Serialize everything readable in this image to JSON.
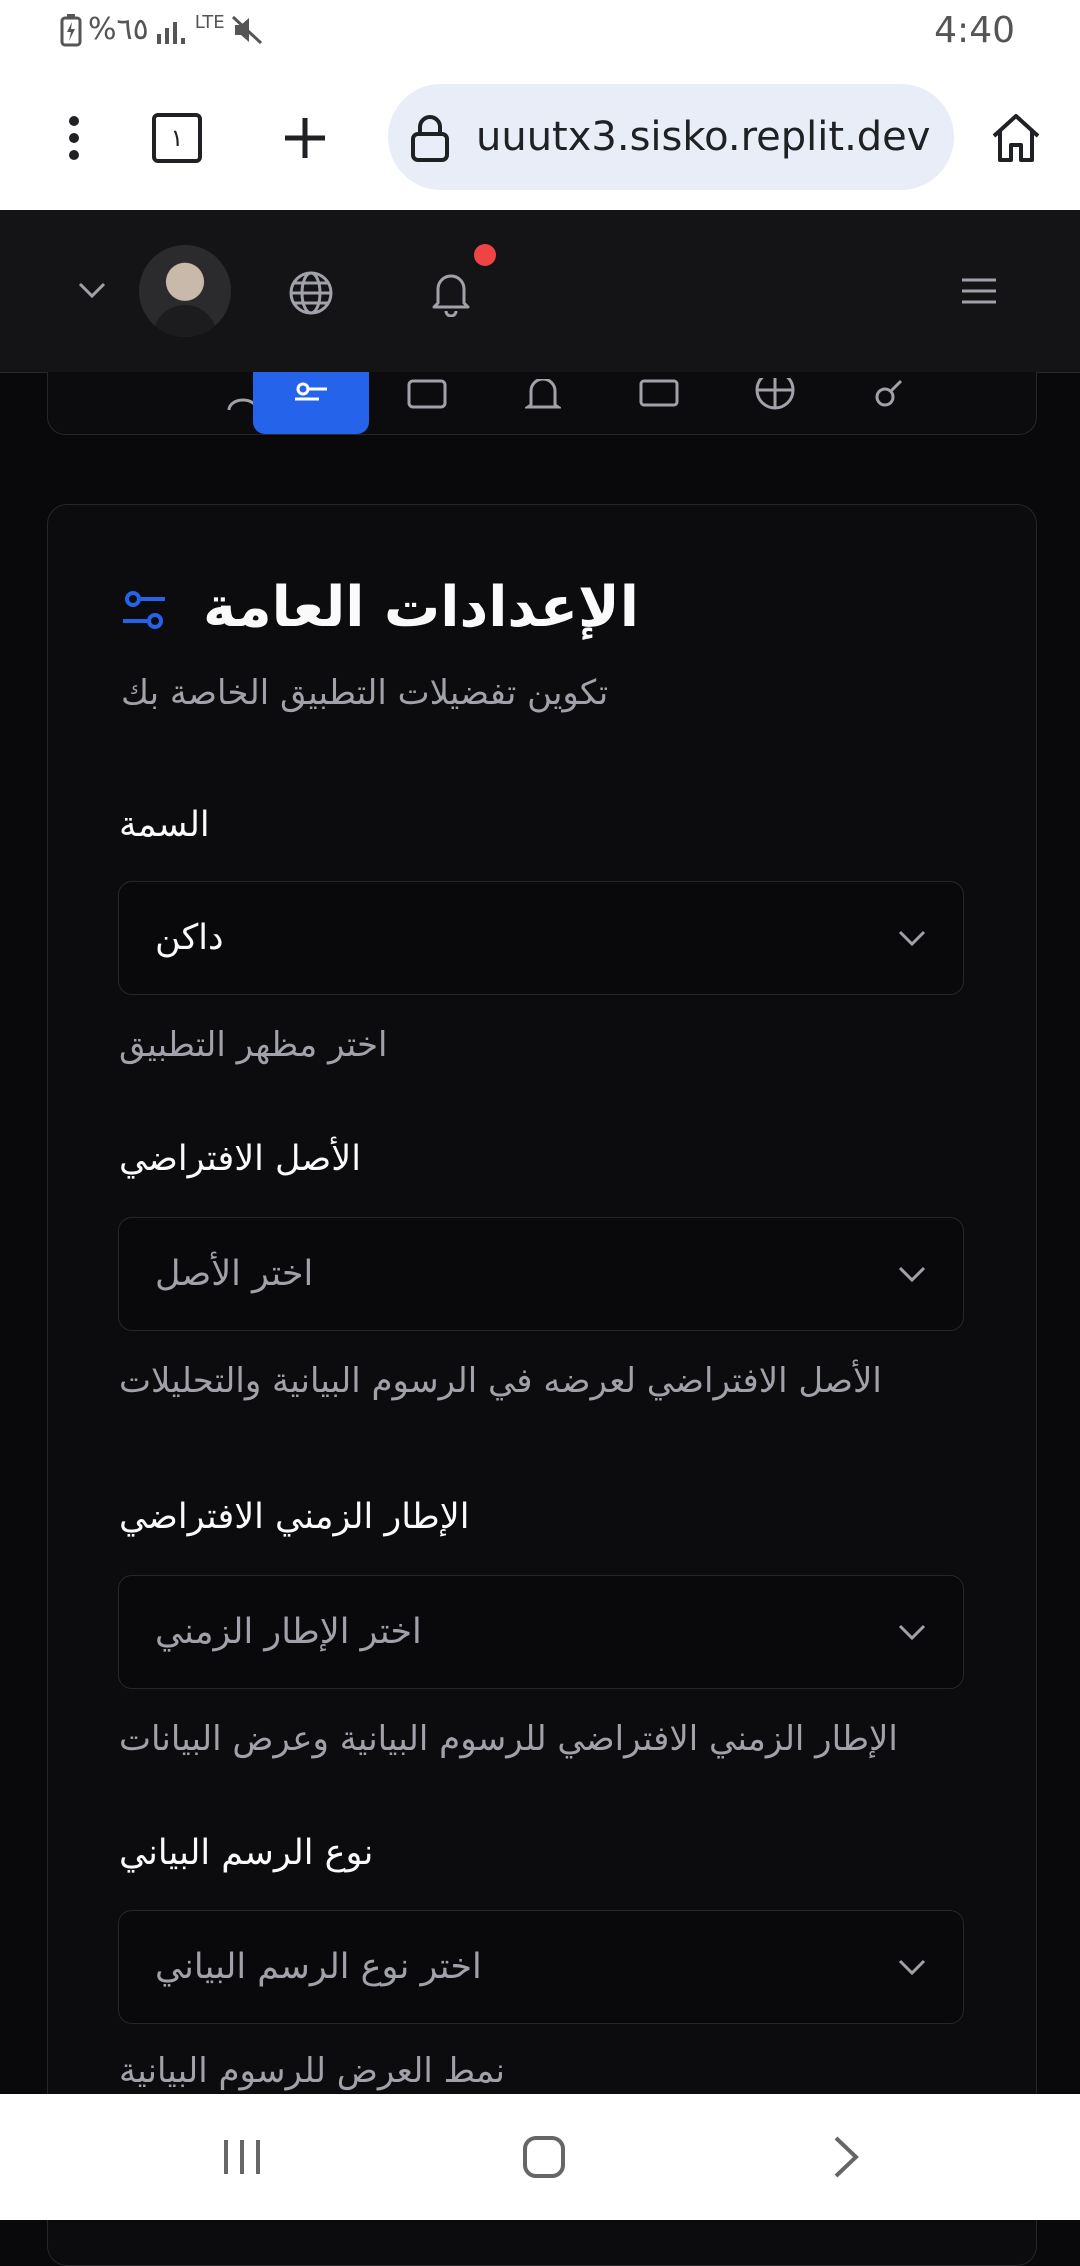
{
  "status_bar": {
    "battery": "%٦٥",
    "network": "LTE",
    "time": "4:40"
  },
  "browser": {
    "tab_count": "١",
    "url": "uuutx3.sisko.replit.dev"
  },
  "header": {
    "has_notification": true
  },
  "settings": {
    "title": "الإعدادات العامة",
    "subtitle": "تكوين تفضيلات التطبيق الخاصة بك",
    "fields": [
      {
        "label": "السمة",
        "value": "داكن",
        "help": "اختر مظهر التطبيق"
      },
      {
        "label": "الأصل الافتراضي",
        "placeholder": "اختر الأصل",
        "help": "الأصل الافتراضي لعرضه في الرسوم البيانية والتحليلات"
      },
      {
        "label": "الإطار الزمني الافتراضي",
        "placeholder": "اختر الإطار الزمني",
        "help": "الإطار الزمني الافتراضي للرسوم البيانية وعرض البيانات"
      },
      {
        "label": "نوع الرسم البياني",
        "placeholder": "اختر نوع الرسم البياني",
        "help": "نمط العرض للرسوم البيانية"
      }
    ]
  },
  "colors": {
    "accent": "#2563eb",
    "background": "#09090b",
    "card": "#0c0c0e",
    "border": "#27272a",
    "text": "#fafafa",
    "muted": "#a1a1aa",
    "notification": "#ef4444"
  }
}
